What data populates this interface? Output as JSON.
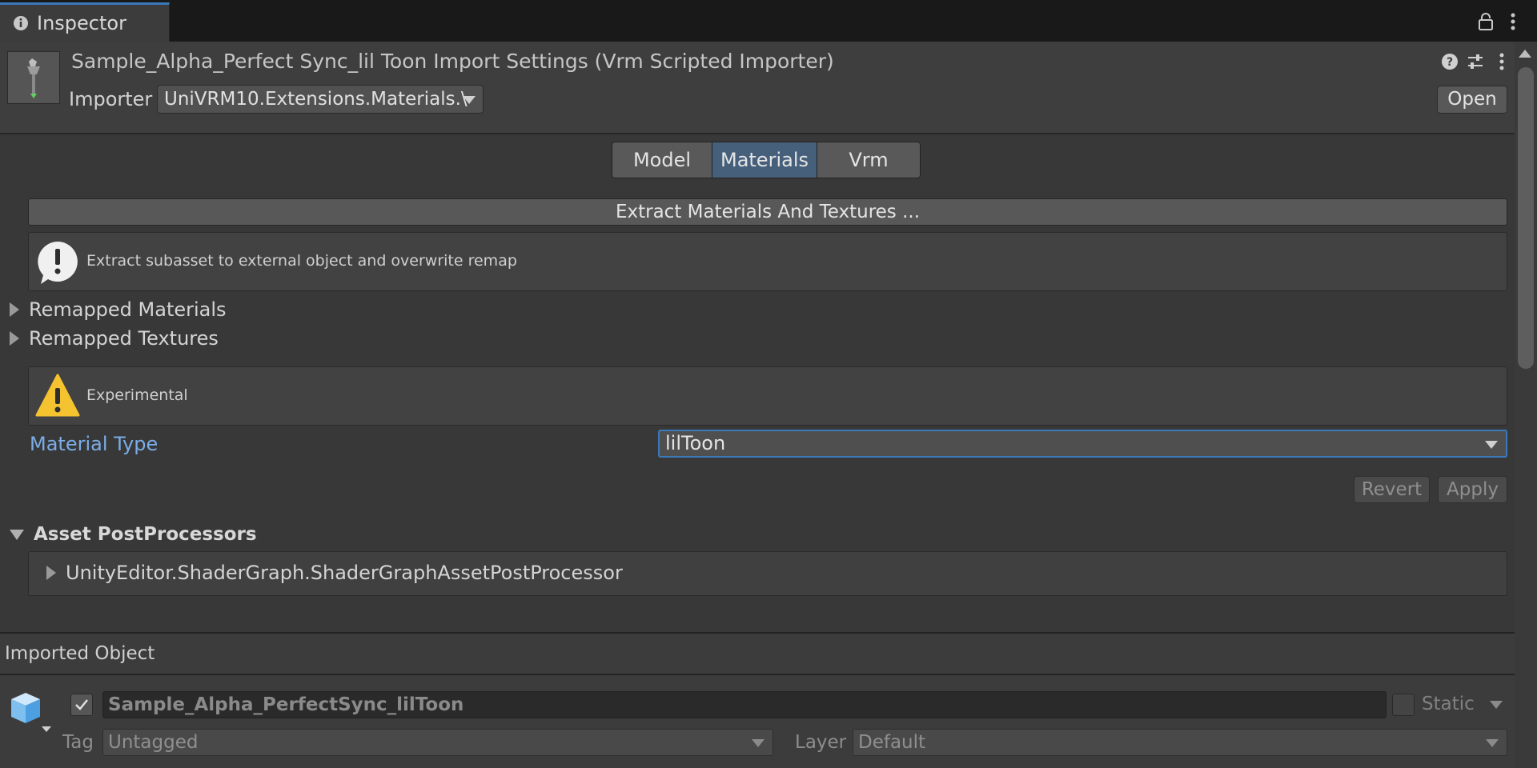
{
  "window": {
    "tab_title": "Inspector"
  },
  "header": {
    "title": "Sample_Alpha_Perfect Sync_lil Toon Import Settings (Vrm Scripted Importer)",
    "importer_label": "Importer",
    "importer_value": "UniVRM10.Extensions.Materials.\\",
    "open_label": "Open"
  },
  "tabs": [
    {
      "label": "Model",
      "active": false
    },
    {
      "label": "Materials",
      "active": true
    },
    {
      "label": "Vrm",
      "active": false
    }
  ],
  "materials": {
    "extract_button": "Extract Materials And Textures ...",
    "extract_help": "Extract subasset to external object and overwrite remap",
    "remapped_materials": "Remapped Materials",
    "remapped_textures": "Remapped Textures",
    "experimental_help": "Experimental",
    "material_type_label": "Material Type",
    "material_type_value": "lilToon",
    "revert_label": "Revert",
    "apply_label": "Apply"
  },
  "postprocessors": {
    "title": "Asset PostProcessors",
    "items": [
      "UnityEditor.ShaderGraph.ShaderGraphAssetPostProcessor"
    ]
  },
  "imported_object": {
    "section_label": "Imported Object",
    "name": "Sample_Alpha_PerfectSync_lilToon",
    "active": true,
    "static_label": "Static",
    "tag_label": "Tag",
    "tag_value": "Untagged",
    "layer_label": "Layer",
    "layer_value": "Default"
  },
  "colors": {
    "accent": "#3a79bb",
    "active_tab": "#46607c",
    "field_label_highlight": "#7bade6",
    "warning": "#f5c330"
  }
}
